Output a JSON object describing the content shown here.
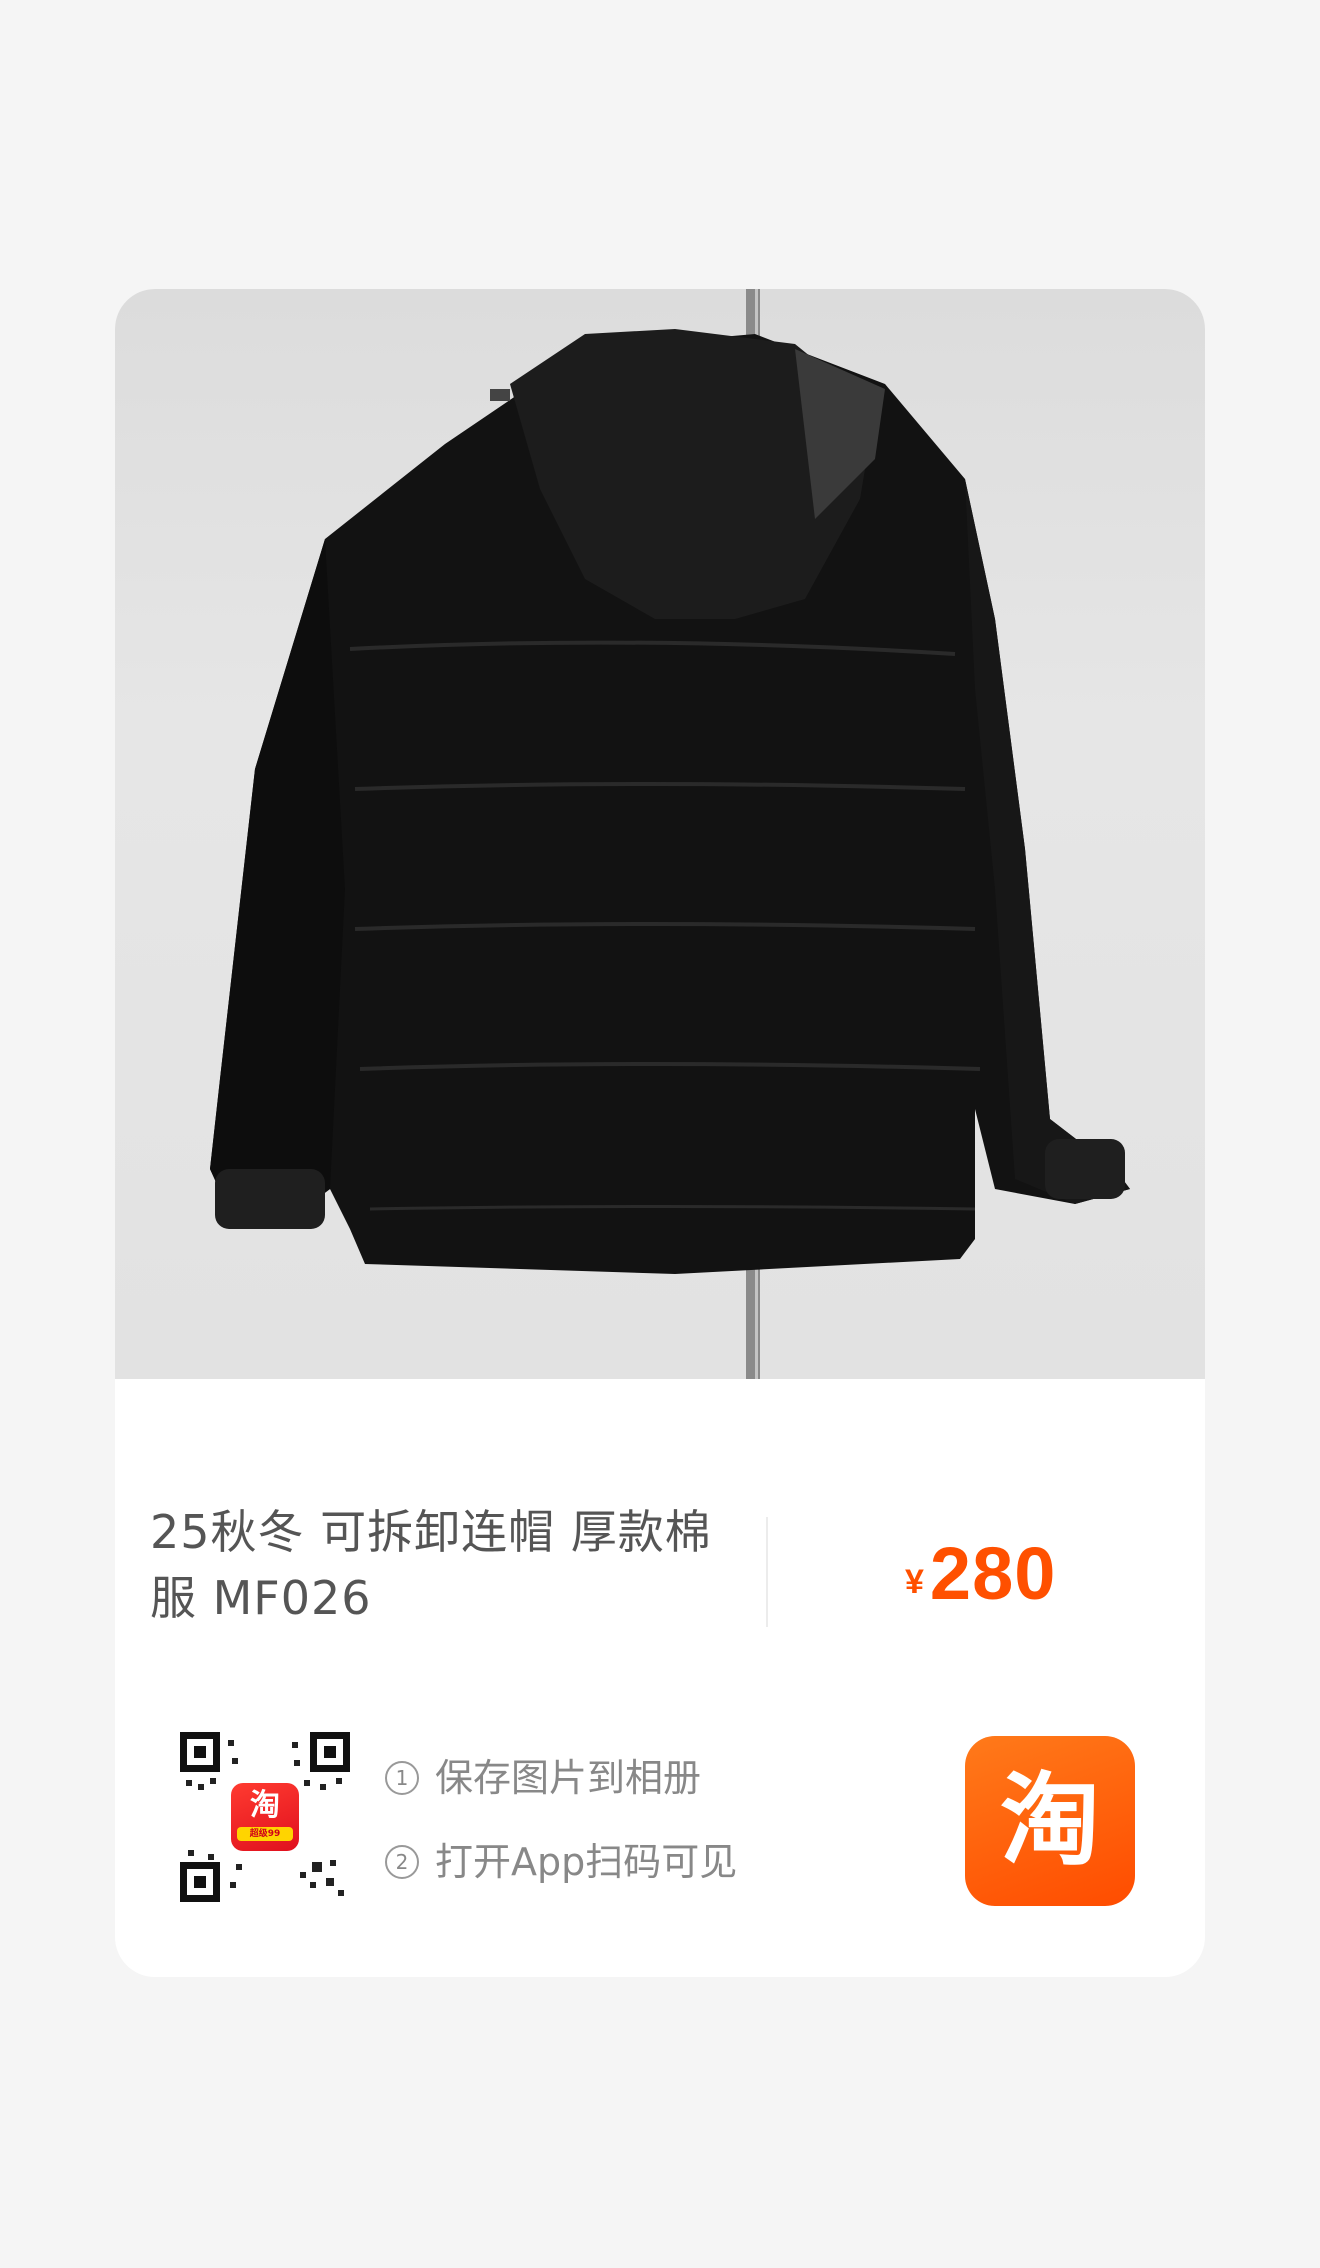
{
  "product": {
    "title": "25秋冬 可拆卸连帽 厚款棉服 MF026",
    "price_currency": "¥",
    "price_amount": "280"
  },
  "qr": {
    "badge_glyph": "淘",
    "badge_sub": "超级99"
  },
  "steps": [
    {
      "num": "1",
      "text": "保存图片到相册"
    },
    {
      "num": "2",
      "text": "打开App扫码可见"
    }
  ],
  "brand": {
    "logo_glyph": "淘",
    "accent": "#ff5000"
  },
  "colors": {
    "background": "#f5f5f5",
    "card": "#ffffff",
    "title_text": "#555555",
    "step_text": "#888888"
  }
}
